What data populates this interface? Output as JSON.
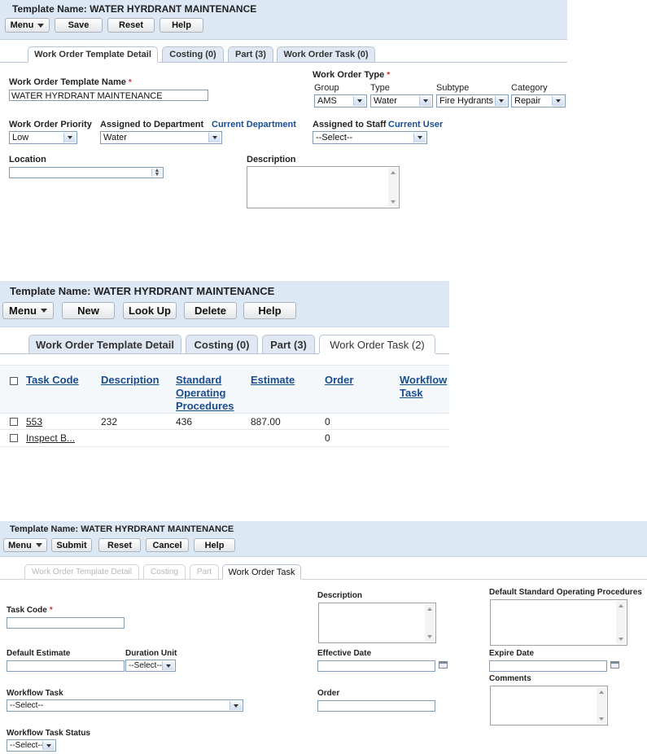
{
  "panel1": {
    "title": "Template Name: WATER HYRDRANT MAINTENANCE",
    "toolbar": {
      "menu": "Menu",
      "save": "Save",
      "reset": "Reset",
      "help": "Help"
    },
    "tabs": [
      "Work Order Template Detail",
      "Costing (0)",
      "Part (3)",
      "Work Order Task (0)"
    ],
    "form": {
      "template_name_label": "Work Order Template Name",
      "template_name_value": "WATER HYRDRANT MAINTENANCE",
      "wo_type_label": "Work Order Type",
      "group_label": "Group",
      "group_value": "AMS",
      "type_label": "Type",
      "type_value": "Water",
      "subtype_label": "Subtype",
      "subtype_value": "Fire Hydrants",
      "category_label": "Category",
      "category_value": "Repair",
      "priority_label": "Work Order Priority",
      "priority_value": "Low",
      "dept_label": "Assigned to Department",
      "dept_link": "Current Department",
      "dept_value": "Water",
      "staff_label": "Assigned to Staff",
      "staff_link": "Current User",
      "staff_value": "--Select--",
      "location_label": "Location",
      "description_label": "Description"
    }
  },
  "panel2": {
    "title": "Template Name: WATER HYRDRANT MAINTENANCE",
    "toolbar": {
      "menu": "Menu",
      "new": "New",
      "lookup": "Look Up",
      "delete": "Delete",
      "help": "Help"
    },
    "tabs": [
      "Work Order Template Detail",
      "Costing (0)",
      "Part (3)",
      "Work Order Task (2)"
    ],
    "table": {
      "columns": {
        "task_code": "Task Code",
        "description": "Description",
        "sop_1": "Standard",
        "sop_2": "Operating",
        "sop_3": "Procedures",
        "estimate": "Estimate",
        "order": "Order",
        "workflow_1": "Workflow",
        "workflow_2": "Task"
      },
      "rows": [
        {
          "task_code": "553",
          "description": "232",
          "sop": "436",
          "estimate": "887.00",
          "order": "0",
          "workflow": ""
        },
        {
          "task_code": "Inspect B...",
          "description": "",
          "sop": "",
          "estimate": "",
          "order": "0",
          "workflow": ""
        }
      ]
    }
  },
  "panel3": {
    "title": "Template Name: WATER HYRDRANT MAINTENANCE",
    "toolbar": {
      "menu": "Menu",
      "submit": "Submit",
      "reset": "Reset",
      "cancel": "Cancel",
      "help": "Help"
    },
    "tabs": [
      "Work Order Template Detail",
      "Costing",
      "Part",
      "Work Order Task"
    ],
    "form": {
      "task_code_label": "Task Code",
      "description_label": "Description",
      "default_sop_label": "Default Standard Operating Procedures",
      "default_estimate_label": "Default Estimate",
      "duration_unit_label": "Duration Unit",
      "duration_unit_value": "--Select--",
      "effective_date_label": "Effective Date",
      "expire_date_label": "Expire Date",
      "comments_label": "Comments",
      "workflow_task_label": "Workflow Task",
      "workflow_task_value": "--Select--",
      "order_label": "Order",
      "workflow_status_label": "Workflow Task Status",
      "workflow_status_value": "--Select--"
    }
  },
  "colors": {
    "header_bg": "#dde8f5",
    "link": "#1a4d8f",
    "required": "#d03030"
  }
}
